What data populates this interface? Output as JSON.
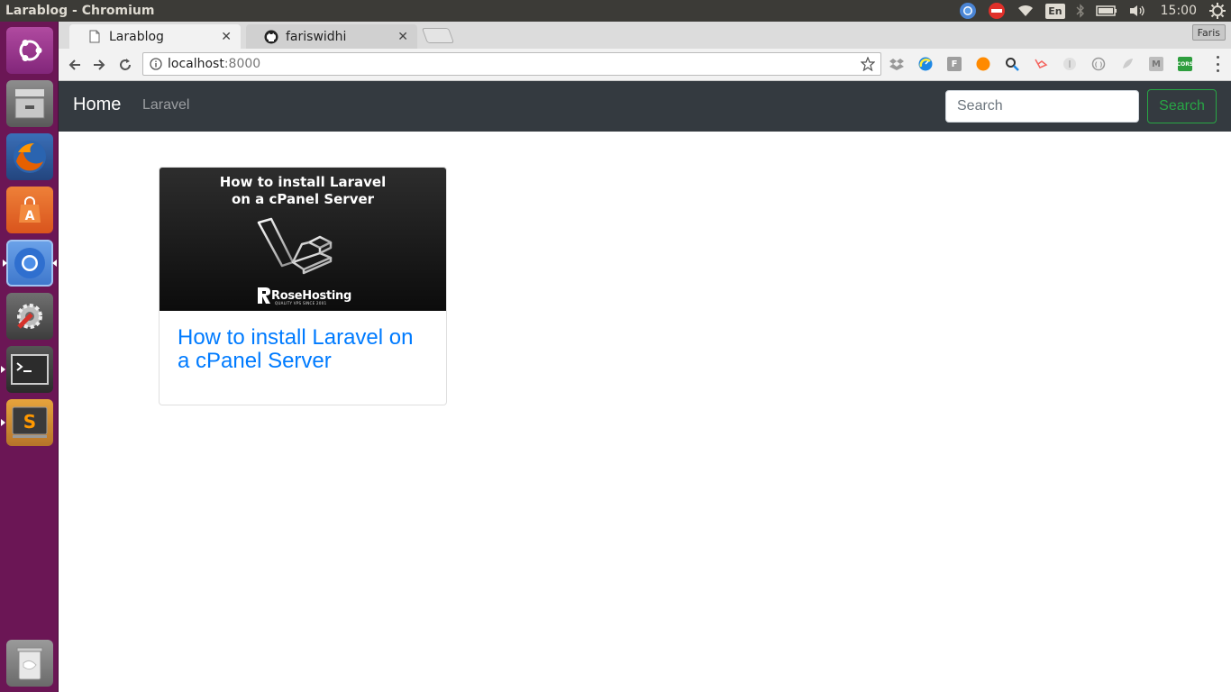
{
  "window": {
    "title": "Larablog - Chromium"
  },
  "system_tray": {
    "keyboard_layout": "En",
    "clock": "15:00",
    "icons": [
      "chromium-tray-icon",
      "stop-icon",
      "wifi-icon",
      "keyboard-layout-icon",
      "bluetooth-icon",
      "battery-icon",
      "volume-icon",
      "settings-gear-icon"
    ]
  },
  "launcher": {
    "items": [
      "ubuntu-dash-icon",
      "files-icon",
      "firefox-icon",
      "software-center-icon",
      "chromium-icon",
      "system-settings-icon",
      "terminal-icon",
      "sublime-text-icon",
      "trash-icon"
    ]
  },
  "browser": {
    "tabs": [
      {
        "label": "Larablog",
        "icon": "page-icon",
        "active": true
      },
      {
        "label": "fariswidhi",
        "icon": "github-icon",
        "active": false
      }
    ],
    "profile_name": "Faris",
    "address": {
      "host": "localhost",
      "port": ":8000"
    },
    "extensions": [
      "dropbox-icon",
      "speed-icon",
      "f-icon",
      "orange-dot-icon",
      "search-ext-icon",
      "laravel-ext-icon",
      "grey-ext-icon",
      "grey-circle-icon",
      "grey-feather-icon",
      "m-icon",
      "cors-icon"
    ],
    "cors_label": "CORS"
  },
  "page": {
    "navbar": {
      "brand": "Home",
      "link": "Laravel",
      "search_placeholder": "Search",
      "search_button": "Search"
    },
    "posts": [
      {
        "image_title_line1": "How to install Laravel",
        "image_title_line2": "on a cPanel Server",
        "image_brand": "RoseHosting",
        "image_tagline": "QUALITY VPS SINCE 2001",
        "title": "How to install Laravel on a cPanel Server"
      }
    ]
  },
  "colors": {
    "launcher_bg": "#6b1655",
    "panel_bg": "#3c3b37",
    "navbar_bg": "#343a40",
    "link_blue": "#007bff",
    "success_green": "#28a745"
  }
}
